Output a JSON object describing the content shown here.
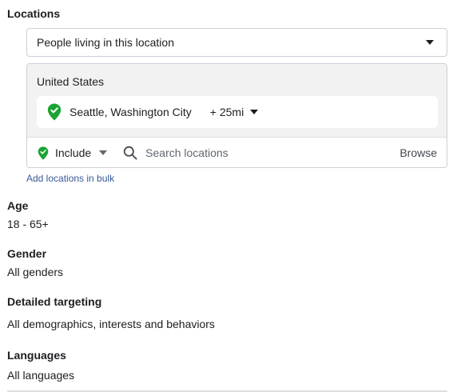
{
  "locations": {
    "heading": "Locations",
    "audience_select": "People living in this location",
    "country": "United States",
    "selected_location": {
      "name": "Seattle, Washington City",
      "radius": "+ 25mi"
    },
    "include_mode": "Include",
    "search_placeholder": "Search locations",
    "browse_label": "Browse",
    "bulk_link": "Add locations in bulk"
  },
  "age": {
    "heading": "Age",
    "value": "18 - 65+"
  },
  "gender": {
    "heading": "Gender",
    "value": "All genders"
  },
  "detailed_targeting": {
    "heading": "Detailed targeting",
    "value": "All demographics, interests and behaviors"
  },
  "languages": {
    "heading": "Languages",
    "value": "All languages"
  },
  "icons": {
    "pin": "location-pin-check-icon",
    "search": "search-icon",
    "caret": "caret-down-icon"
  },
  "colors": {
    "pin_green": "#1ba334",
    "link_blue": "#385898",
    "panel_gray": "#f2f2f2",
    "border": "#ccd0d5"
  }
}
